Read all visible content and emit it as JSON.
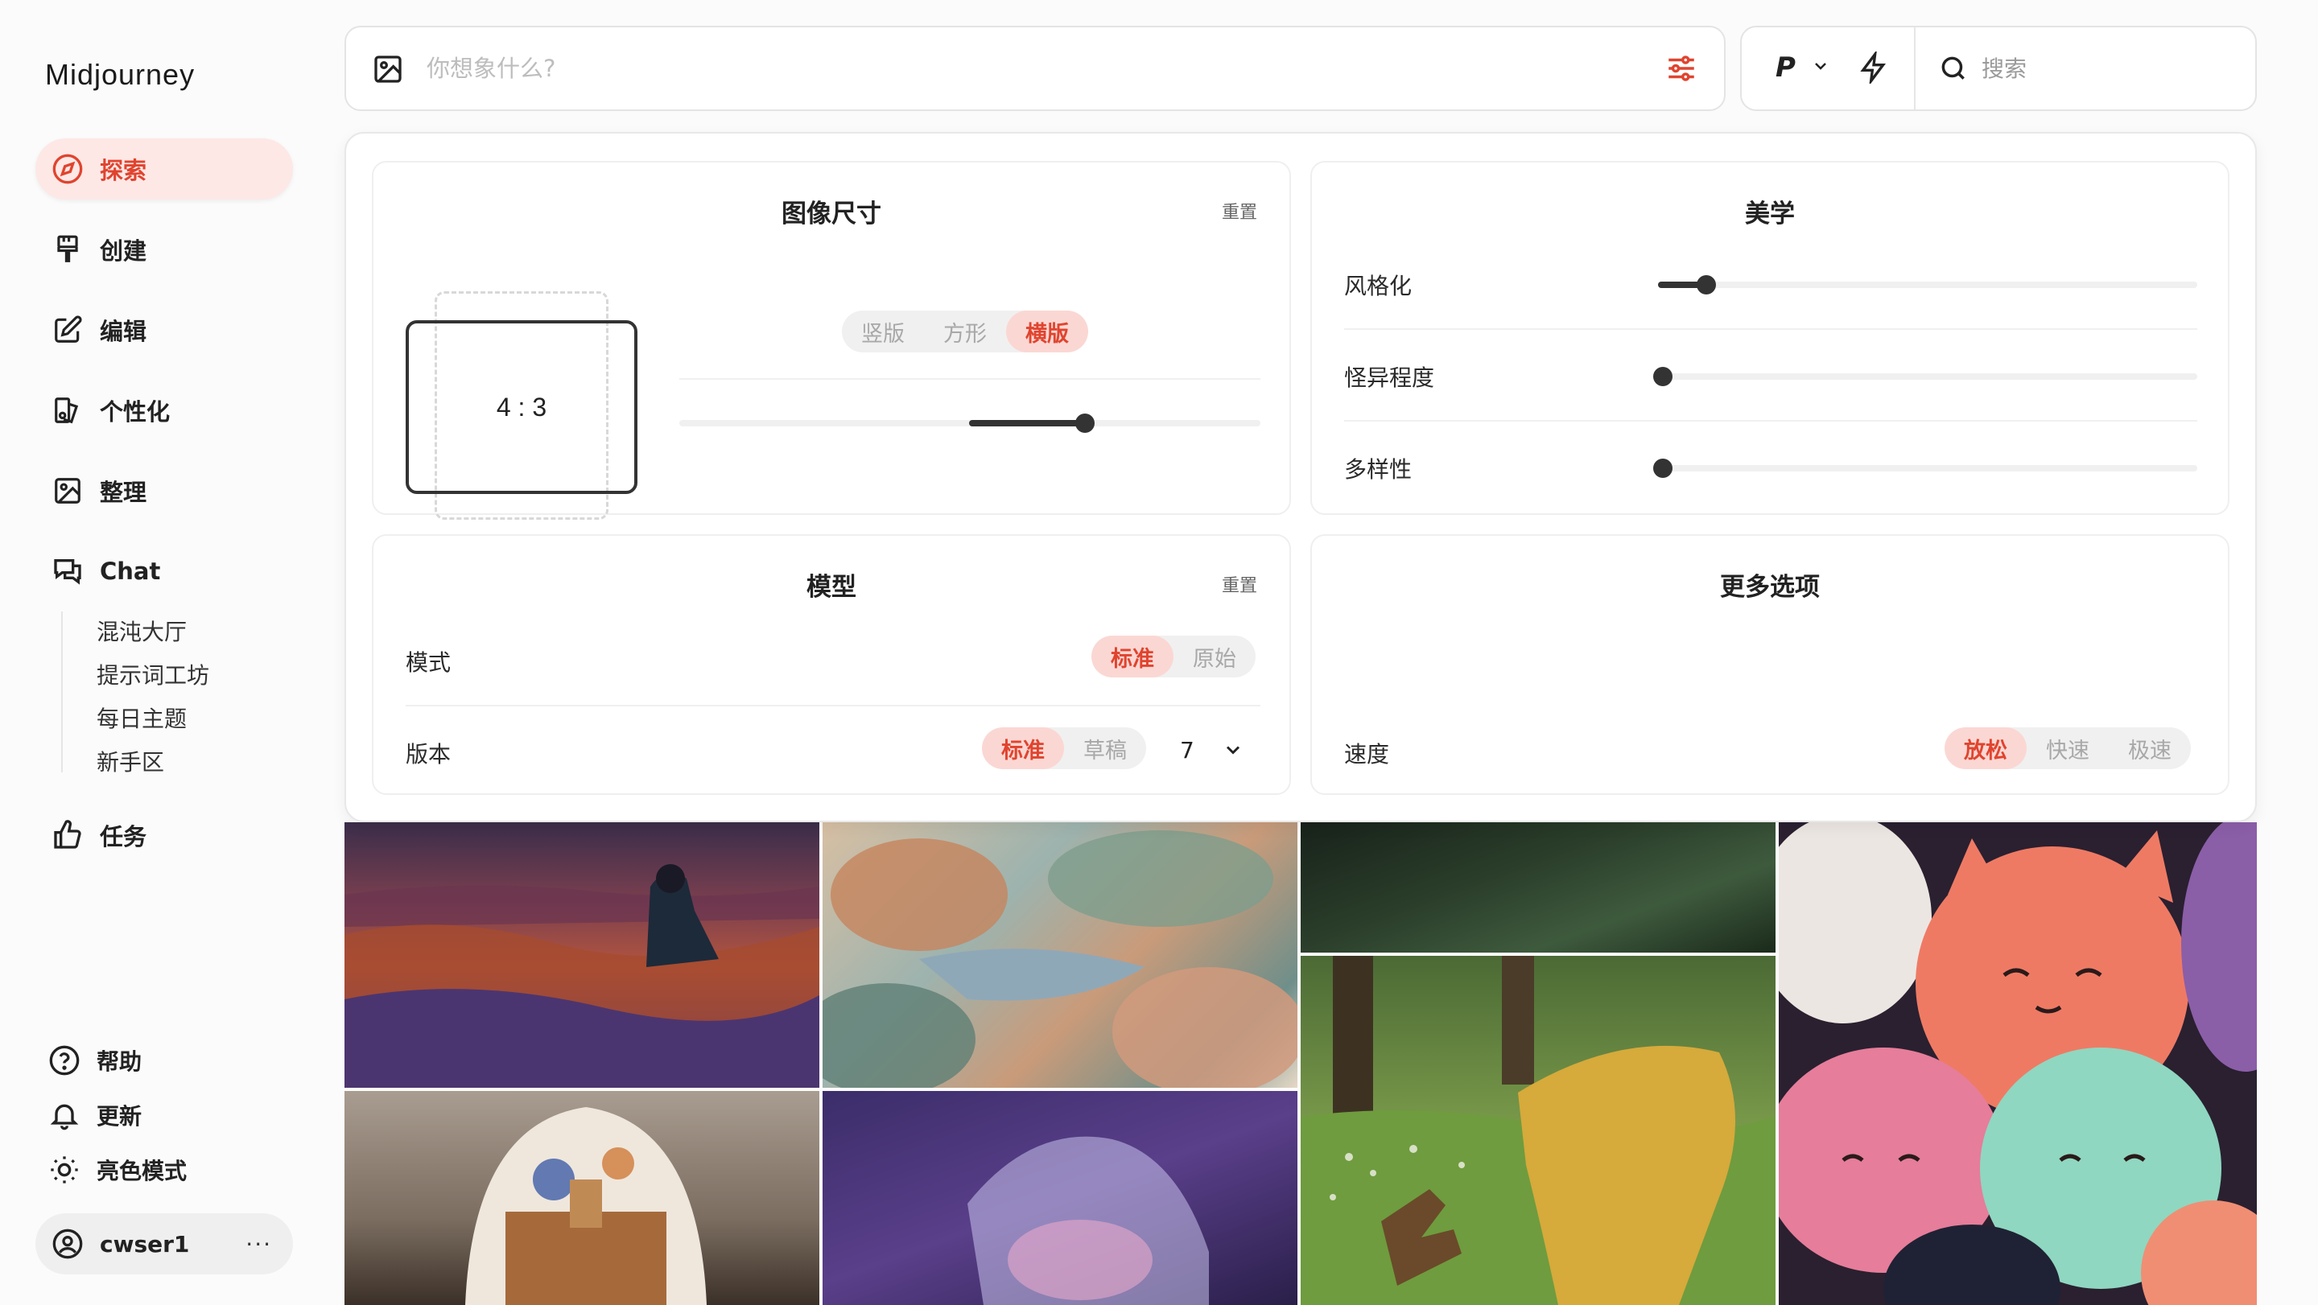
{
  "app": {
    "title": "Midjourney"
  },
  "sidebar": {
    "items": [
      {
        "label": "探索",
        "icon": "compass-icon",
        "active": true
      },
      {
        "label": "创建",
        "icon": "paintbrush-icon"
      },
      {
        "label": "编辑",
        "icon": "edit-icon"
      },
      {
        "label": "个性化",
        "icon": "personalize-icon"
      },
      {
        "label": "整理",
        "icon": "image-icon"
      },
      {
        "label": "Chat",
        "icon": "chat-icon"
      }
    ],
    "chat_subitems": [
      "混沌大厅",
      "提示词工坊",
      "每日主题",
      "新手区"
    ],
    "tasks": {
      "label": "任务",
      "icon": "thumbs-up-icon"
    },
    "bottom": [
      {
        "label": "帮助",
        "icon": "help-icon"
      },
      {
        "label": "更新",
        "icon": "bell-icon"
      },
      {
        "label": "亮色模式",
        "icon": "sun-icon"
      }
    ],
    "user": {
      "name": "cwser1",
      "more": "···"
    }
  },
  "prompt": {
    "placeholder": "你想象什么?"
  },
  "topright": {
    "personalize_label": "P",
    "search_placeholder": "搜索"
  },
  "panel": {
    "image_size": {
      "title": "图像尺寸",
      "reset": "重置",
      "ratio": "4 : 3",
      "orientation": [
        "竖版",
        "方形",
        "横版"
      ],
      "selected_orientation": "横版",
      "slider_value": 0.7
    },
    "aesthetics": {
      "title": "美学",
      "rows": [
        {
          "label": "风格化",
          "value": 0.1
        },
        {
          "label": "怪异程度",
          "value": 0
        },
        {
          "label": "多样性",
          "value": 0
        }
      ]
    },
    "model": {
      "title": "模型",
      "reset": "重置",
      "mode_label": "模式",
      "mode_options": [
        "标准",
        "原始"
      ],
      "mode_selected": "标准",
      "version_label": "版本",
      "version_options": [
        "标准",
        "草稿"
      ],
      "version_selected": "标准",
      "version_number": "7"
    },
    "more": {
      "title": "更多选项",
      "speed_label": "速度",
      "speed_options": [
        "放松",
        "快速",
        "极速"
      ],
      "speed_selected": "放松"
    }
  },
  "colors": {
    "accent": "#e0442f",
    "accent_bg": "#fbd7d3"
  }
}
